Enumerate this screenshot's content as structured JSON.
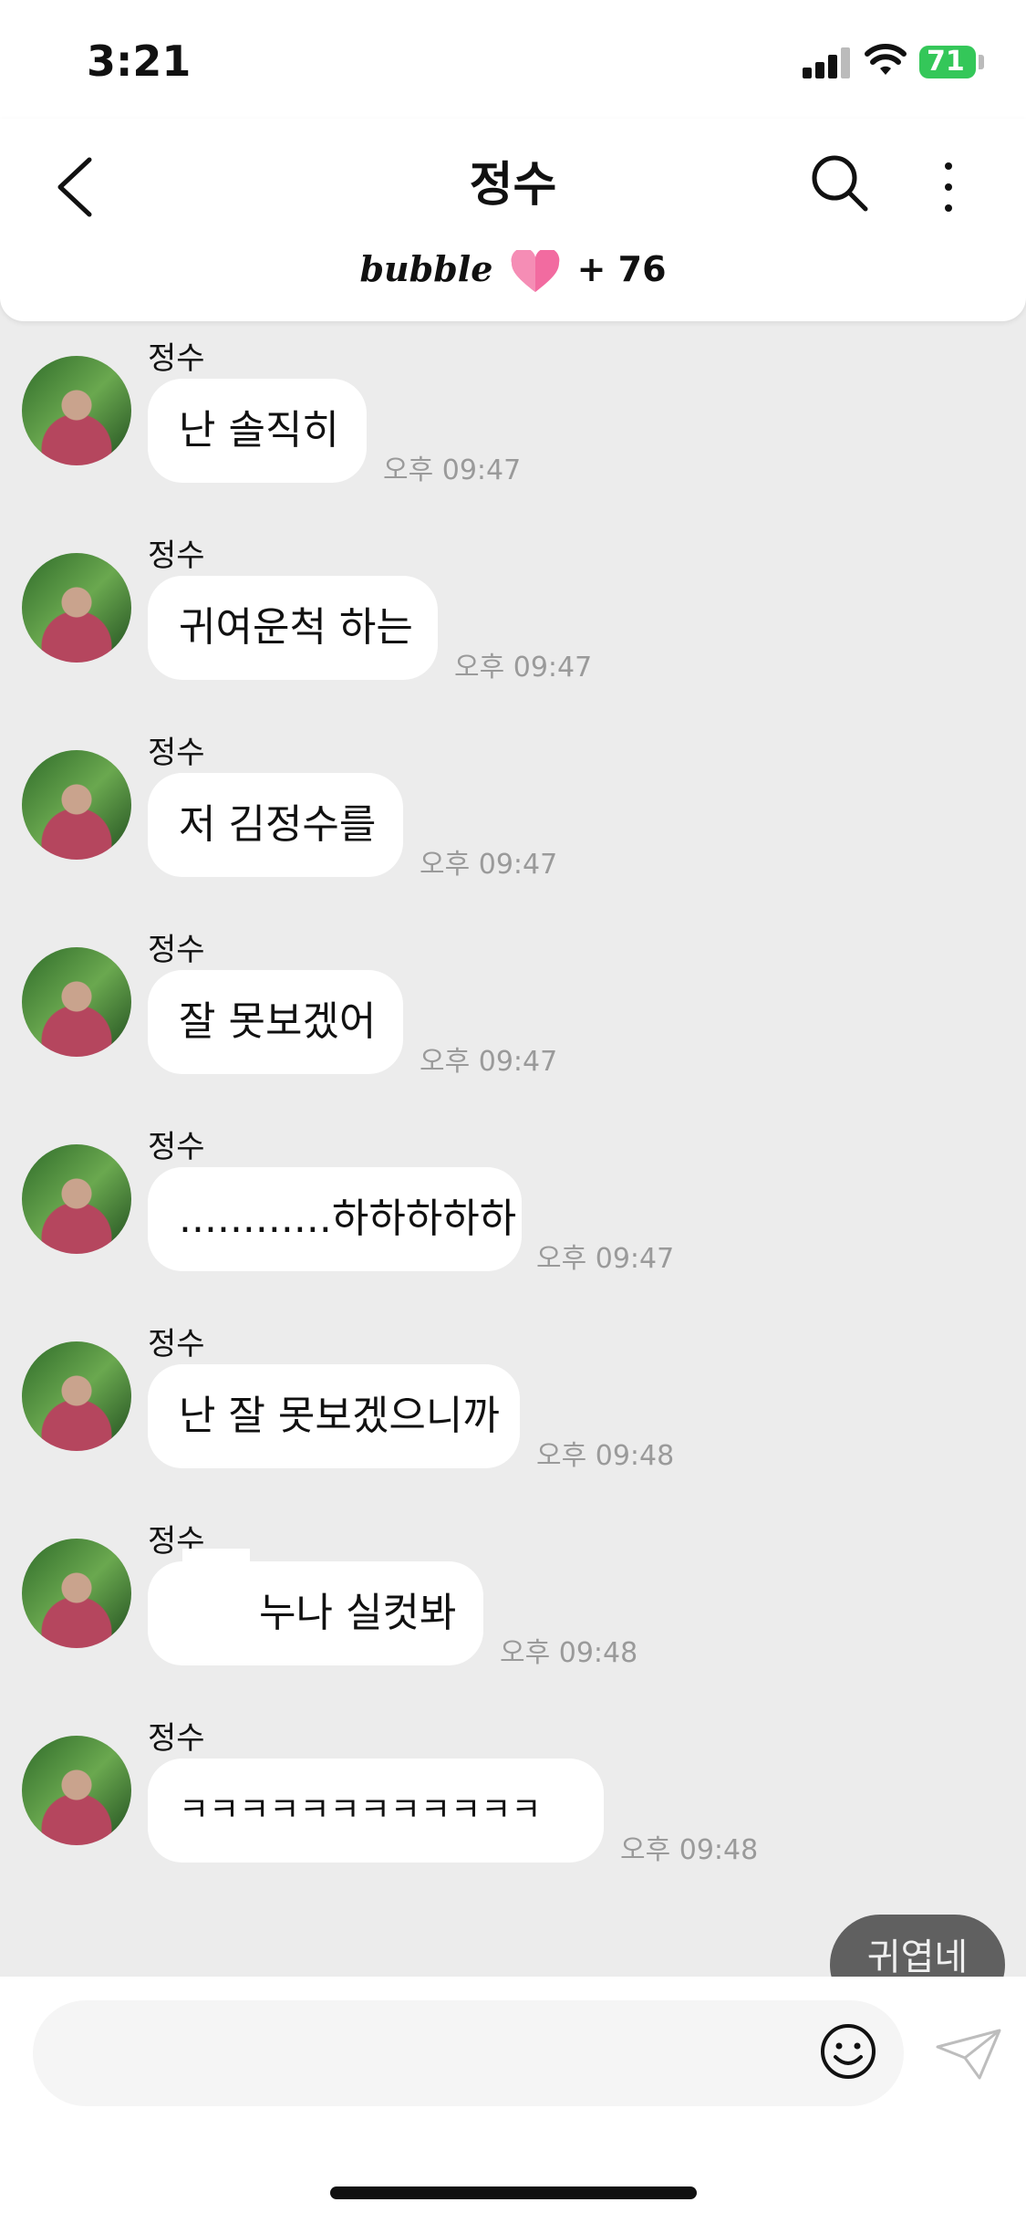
{
  "status": {
    "time": "3:21",
    "battery": "71"
  },
  "header": {
    "title": "정수",
    "brand": "bubble",
    "count": "+ 76"
  },
  "messages": [
    {
      "sender": "정수",
      "text": "난 솔직히",
      "time": "오후 09:47"
    },
    {
      "sender": "정수",
      "text": "귀여운척 하는",
      "time": "오후 09:47"
    },
    {
      "sender": "정수",
      "text": "저 김정수를",
      "time": "오후 09:47"
    },
    {
      "sender": "정수",
      "text": "잘 못보겠어",
      "time": "오후 09:47"
    },
    {
      "sender": "정수",
      "text": "............하하하하하",
      "time": "오후 09:47"
    },
    {
      "sender": "정수",
      "text": "난 잘 못보겠으니까",
      "time": "오후 09:48"
    },
    {
      "sender": "정수",
      "text": "누나 실컷봐",
      "time": "오후 09:48"
    },
    {
      "sender": "정수",
      "text": "ㅋㅋㅋㅋㅋㅋㅋㅋㅋㅋㅋㅋ",
      "time": "오후 09:48"
    }
  ],
  "my_message": {
    "text": "귀엽네"
  },
  "input": {
    "placeholder": ""
  },
  "colors": {
    "accent_heart": "#f26ba0",
    "battery": "#34c759",
    "my_bubble": "#606060"
  }
}
